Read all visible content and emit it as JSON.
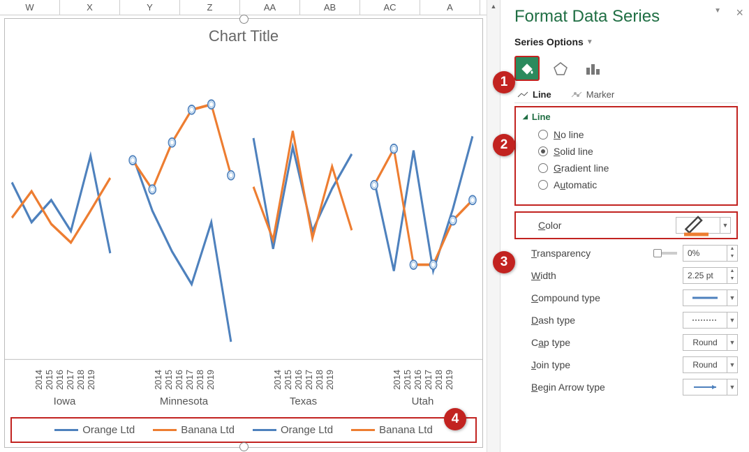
{
  "columns": [
    "W",
    "X",
    "Y",
    "Z",
    "AA",
    "AB",
    "AC",
    "A"
  ],
  "pane": {
    "title": "Format Data Series",
    "series_options": "Series Options",
    "tabs": {
      "line": "Line",
      "marker": "Marker"
    },
    "section": "Line",
    "radios": {
      "none": "No line",
      "solid": "Solid line",
      "grad": "Gradient line",
      "auto": "Automatic",
      "selected": "solid"
    },
    "color": {
      "label": "Color"
    },
    "transparency": {
      "label": "Transparency",
      "value": "0%"
    },
    "width": {
      "label": "Width",
      "value": "2.25 pt"
    },
    "compound": {
      "label": "Compound type"
    },
    "dash": {
      "label": "Dash type"
    },
    "cap": {
      "label": "Cap type",
      "value": "Round"
    },
    "join": {
      "label": "Join type",
      "value": "Round"
    },
    "beginarrow": {
      "label": "Begin Arrow type"
    }
  },
  "chart": {
    "title": "Chart Title",
    "states": [
      "Iowa",
      "Minnesota",
      "Texas",
      "Utah"
    ],
    "years": [
      "2014",
      "2015",
      "2016",
      "2017",
      "2018",
      "2019"
    ],
    "legend": [
      "Orange Ltd",
      "Banana Ltd",
      "Orange Ltd",
      "Banana Ltd"
    ]
  },
  "badges": [
    "1",
    "2",
    "3",
    "4"
  ],
  "chart_data": {
    "type": "line",
    "title": "Chart Title",
    "xlabel": "",
    "ylabel": "",
    "x_groups": [
      "Iowa",
      "Minnesota",
      "Texas",
      "Utah"
    ],
    "x_inner": [
      "2014",
      "2015",
      "2016",
      "2017",
      "2018",
      "2019"
    ],
    "ylim": [
      0,
      100
    ],
    "note": "Axis has no visible numeric ticks; values below are relative 0–100 estimates from chart pixel positions (higher = higher on chart).",
    "series": [
      {
        "name": "Orange Ltd",
        "group": "Iowa",
        "color": "#4e81bd",
        "values": [
          60,
          44,
          54,
          40,
          70,
          30
        ]
      },
      {
        "name": "Banana Ltd",
        "group": "Iowa",
        "color": "#ed7d31",
        "values": [
          45,
          56,
          42,
          34,
          48,
          62
        ]
      },
      {
        "name": "Orange Ltd",
        "group": "Minnesota",
        "color": "#4e81bd",
        "values": [
          70,
          50,
          32,
          20,
          46,
          6
        ]
      },
      {
        "name": "Banana Ltd",
        "group": "Minnesota",
        "color": "#ed7d31",
        "values": [
          68,
          56,
          75,
          85,
          86,
          62
        ]
      },
      {
        "name": "Orange Ltd",
        "group": "Texas",
        "color": "#4e81bd",
        "values": [
          76,
          32,
          74,
          40,
          58,
          72
        ]
      },
      {
        "name": "Banana Ltd",
        "group": "Texas",
        "color": "#ed7d31",
        "values": [
          58,
          36,
          78,
          36,
          66,
          40
        ]
      },
      {
        "name": "Orange Ltd",
        "group": "Utah",
        "color": "#4e81bd",
        "values": [
          60,
          24,
          72,
          24,
          50,
          78
        ]
      },
      {
        "name": "Banana Ltd",
        "group": "Utah",
        "color": "#ed7d31",
        "values": [
          58,
          72,
          26,
          26,
          44,
          52
        ]
      }
    ]
  }
}
